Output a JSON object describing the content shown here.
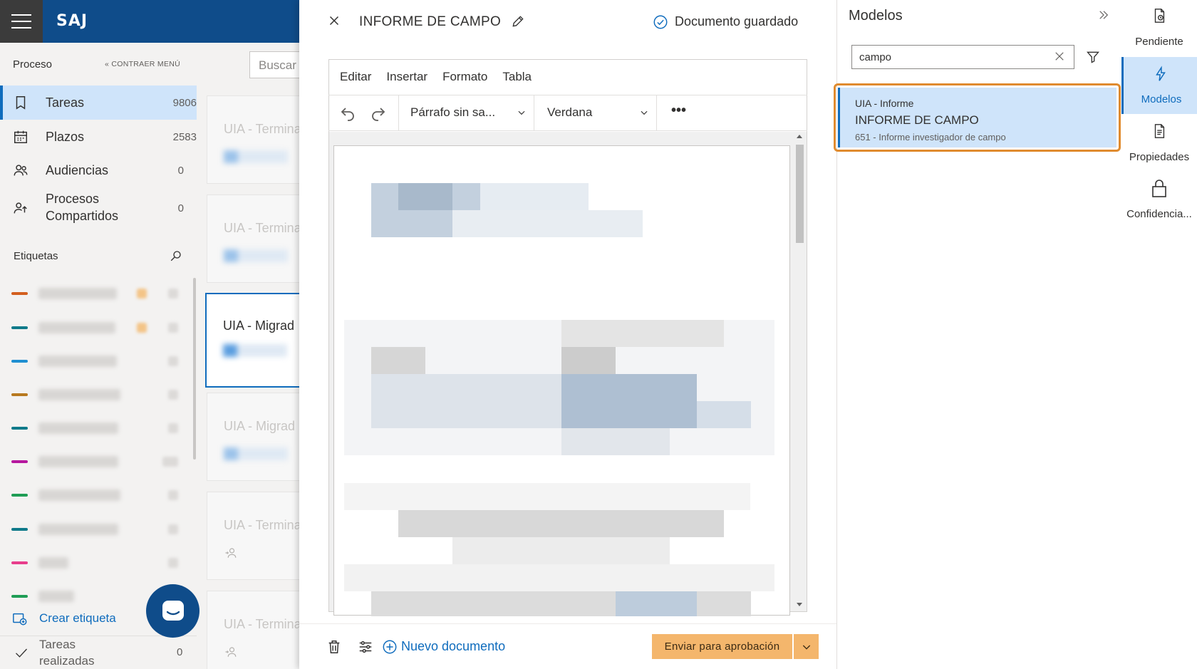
{
  "app": {
    "logo": "SAJ"
  },
  "sidebar": {
    "section_title": "Proceso",
    "collapse_label": "« CONTRAER MENÚ",
    "nav": [
      {
        "label": "Tareas",
        "count": "9806",
        "icon": "bookmark-icon"
      },
      {
        "label": "Plazos",
        "count": "2583",
        "icon": "calendar-icon"
      },
      {
        "label": "Audiencias",
        "count": "0",
        "icon": "people-icon"
      },
      {
        "label": "Procesos",
        "label2": "Compartidos",
        "count": "0",
        "icon": "shared-people-icon"
      }
    ],
    "tags_title": "Etiquetas",
    "tag_colors": [
      "#d35f1e",
      "#0f7a8a",
      "#1f8fd1",
      "#b7791f",
      "#0f7a8a",
      "#b5179e",
      "#1f9d55",
      "#0f7a8a",
      "#e83e8c",
      "#1f9d55"
    ],
    "create_tag": "Crear etiqueta",
    "done_tasks_line1": "Tareas",
    "done_tasks_line2": "realizadas",
    "done_tasks_count": "0"
  },
  "tasklist": {
    "search_placeholder": "Buscar",
    "cards": [
      {
        "title": "UIA - Termina"
      },
      {
        "title": "UIA - Termina"
      },
      {
        "title": "UIA - Migrad"
      },
      {
        "title": "UIA - Migrad"
      },
      {
        "title": "UIA - Termina"
      },
      {
        "title": "UIA - Termina"
      }
    ]
  },
  "editor": {
    "title": "INFORME DE CAMPO",
    "saved_status": "Documento guardado",
    "menu": [
      "Editar",
      "Insertar",
      "Formato",
      "Tabla"
    ],
    "paragraph_style": "Párrafo sin sa...",
    "font": "Verdana",
    "more": "•••",
    "new_document": "Nuevo documento",
    "send_button": "Enviar para aprobación"
  },
  "models": {
    "title": "Modelos",
    "search_value": "campo",
    "item": {
      "category": "UIA - Informe",
      "name": "INFORME DE CAMPO",
      "subtitle": "651 - Informe investigador de campo"
    }
  },
  "rail": [
    {
      "label": "Pendiente",
      "icon": "document-clock-icon"
    },
    {
      "label": "Modelos",
      "icon": "lightning-icon"
    },
    {
      "label": "Propiedades",
      "icon": "document-list-icon"
    },
    {
      "label": "Confidencia...",
      "icon": "lock-icon"
    }
  ],
  "colors": {
    "brand": "#0f4c8a",
    "accent": "#0f6cbd",
    "selection": "#cfe4fa",
    "highlight": "#e08b2f",
    "send": "#f4b66c"
  }
}
